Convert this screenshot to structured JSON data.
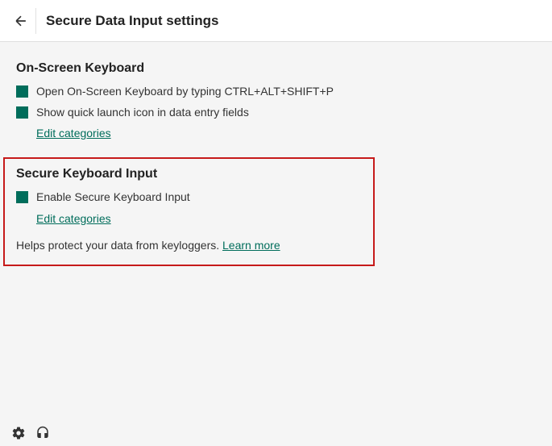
{
  "header": {
    "title": "Secure Data Input settings"
  },
  "sections": {
    "onScreenKeyboard": {
      "title": "On-Screen Keyboard",
      "option1": "Open On-Screen Keyboard by typing CTRL+ALT+SHIFT+P",
      "option2": "Show quick launch icon in data entry fields",
      "editLink": "Edit categories"
    },
    "secureKeyboard": {
      "title": "Secure Keyboard Input",
      "option1": "Enable Secure Keyboard Input",
      "editLink": "Edit categories",
      "description": "Helps protect your data from keyloggers. ",
      "learnMore": "Learn more"
    }
  },
  "colors": {
    "accent": "#006d5b",
    "highlight": "#c61a1a"
  }
}
